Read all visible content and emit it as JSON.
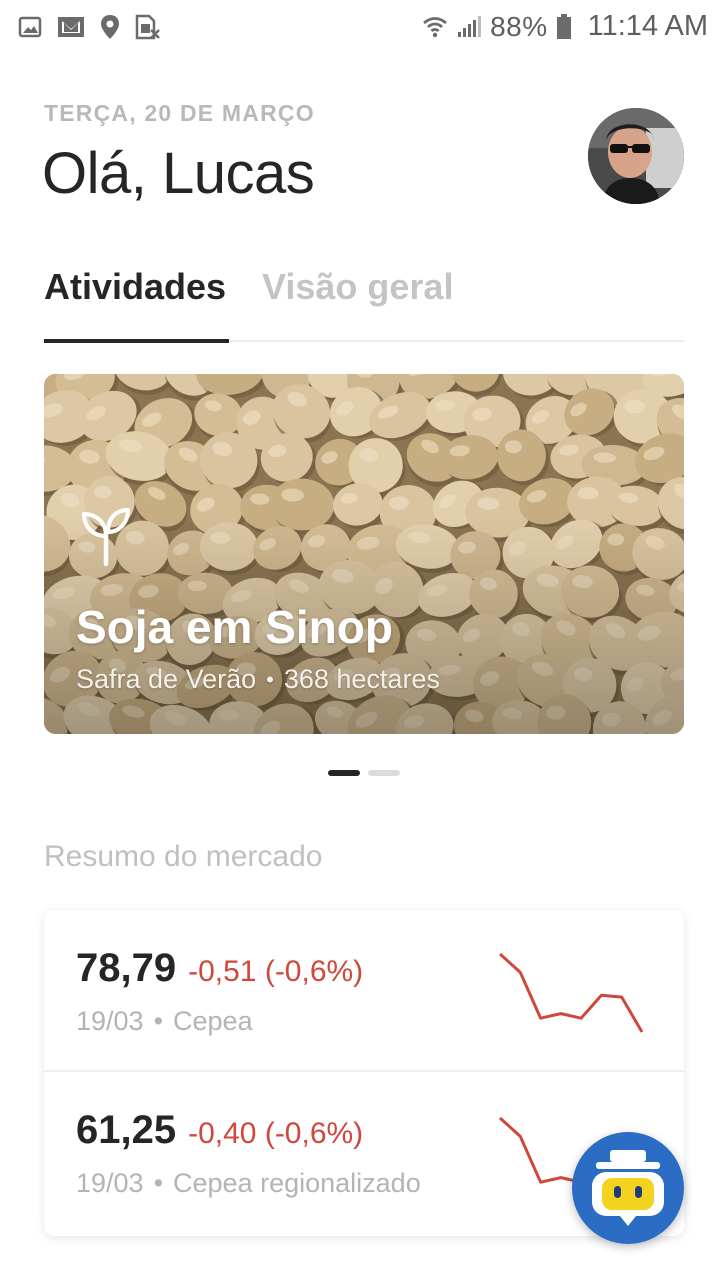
{
  "status_bar": {
    "battery": "88%",
    "time": "11:14 AM",
    "icons": [
      "image-icon",
      "mail-icon",
      "location-icon",
      "sim-off-icon",
      "wifi-icon",
      "signal-icon",
      "battery-icon"
    ]
  },
  "header": {
    "date": "TERÇA, 20 DE MARÇO",
    "greeting": "Olá, Lucas"
  },
  "tabs": [
    {
      "label": "Atividades",
      "active": true
    },
    {
      "label": "Visão geral",
      "active": false
    }
  ],
  "card": {
    "icon": "sprout-icon",
    "title": "Soja em Sinop",
    "season": "Safra de Verão",
    "area": "368 hectares"
  },
  "pager": {
    "pages": 2,
    "current": 1
  },
  "market": {
    "title": "Resumo do mercado",
    "items": [
      {
        "price": "78,79",
        "change": "-0,51 (-0,6%)",
        "date": "19/03",
        "source": "Cepea",
        "trend": [
          9,
          7,
          2,
          2.5,
          2,
          4.5,
          4.3,
          0.5
        ]
      },
      {
        "price": "61,25",
        "change": "-0,40 (-0,6%)",
        "date": "19/03",
        "source": "Cepea regionalizado",
        "trend": [
          9,
          7,
          2,
          2.5,
          2,
          4.5,
          4.3,
          0.5
        ]
      }
    ]
  },
  "colors": {
    "accent": "#2b6cc4",
    "negative": "#d0473b",
    "text": "#262626",
    "muted": "#b4b4b4"
  }
}
